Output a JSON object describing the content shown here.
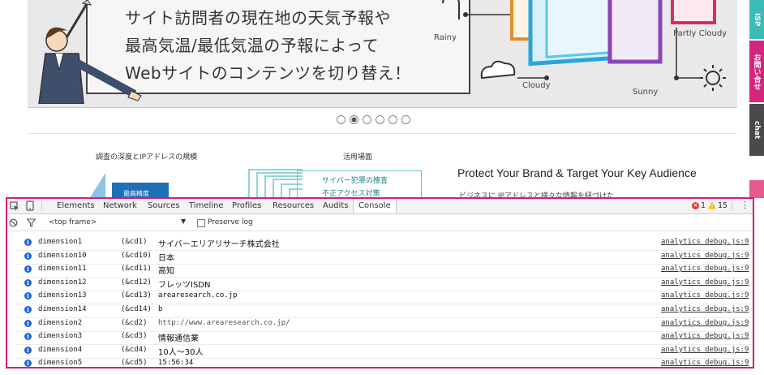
{
  "site": {
    "hero": {
      "lines": [
        "サイト訪問者の現在地の天気予報や",
        "最高気温/最低気温の予報によって",
        "Webサイトのコンテンツを切り替え！"
      ],
      "weather_labels": [
        "Rainy",
        "Partly Cloudy",
        "Cloudy",
        "Sunny"
      ]
    },
    "carousel": {
      "count": 6,
      "active_index": 1
    },
    "section_left_title": "調査の深度とIPアドレスの規模",
    "section_left_badge": "最高精度",
    "section_mid_title": "活用場面",
    "section_mid_items": [
      "サイバー犯罪の捜査",
      "不正アクセス対策"
    ],
    "tagline": "Protect Your Brand & Target Your Key Audience",
    "tagline_sub": "ビジネスに IPアドレスと様々な情報を紐づけた",
    "side_tabs": [
      "ISP",
      "お問い合せ",
      "chat"
    ]
  },
  "devtools": {
    "tabs": [
      "Elements",
      "Network",
      "Sources",
      "Timeline",
      "Profiles",
      "Resources",
      "Audits",
      "Console"
    ],
    "active_tab": "Console",
    "errors": "1",
    "warnings": "15",
    "frame_select": "<top frame>",
    "preserve_log": "Preserve log",
    "rows": [
      {
        "key": "dimension1",
        "cd": "(&cd1)",
        "value": "サイバーエリアリサーチ株式会社",
        "source": "analytics_debug.js:9"
      },
      {
        "key": "dimension10",
        "cd": "(&cd10)",
        "value": "日本",
        "source": "analytics_debug.js:9"
      },
      {
        "key": "dimension11",
        "cd": "(&cd11)",
        "value": "高知",
        "source": "analytics_debug.js:9"
      },
      {
        "key": "dimension12",
        "cd": "(&cd12)",
        "value": "フレッツISDN",
        "source": "analytics_debug.js:9"
      },
      {
        "key": "dimension13",
        "cd": "(&cd13)",
        "value": "arearesearch.co.jp",
        "source": "analytics_debug.js:9"
      },
      {
        "key": "dimension14",
        "cd": "(&cd14)",
        "value": "b",
        "source": "analytics_debug.js:9"
      },
      {
        "key": "dimension2",
        "cd": "(&cd2)",
        "value": "http://www.arearesearch.co.jp/",
        "source": "analytics_debug.js:9"
      },
      {
        "key": "dimension3",
        "cd": "(&cd3)",
        "value": "情報通信業",
        "source": "analytics_debug.js:9"
      },
      {
        "key": "dimension4",
        "cd": "(&cd4)",
        "value": "10人～30人",
        "source": "analytics_debug.js:9"
      },
      {
        "key": "dimension5",
        "cd": "(&cd5)",
        "value": "15:56:34",
        "source": "analytics_debug.js:9"
      }
    ]
  },
  "colors": {
    "highlight_border": "#d81b7a",
    "info_icon": "#1e64d4",
    "error": "#e53935",
    "warning": "#f0b400"
  }
}
